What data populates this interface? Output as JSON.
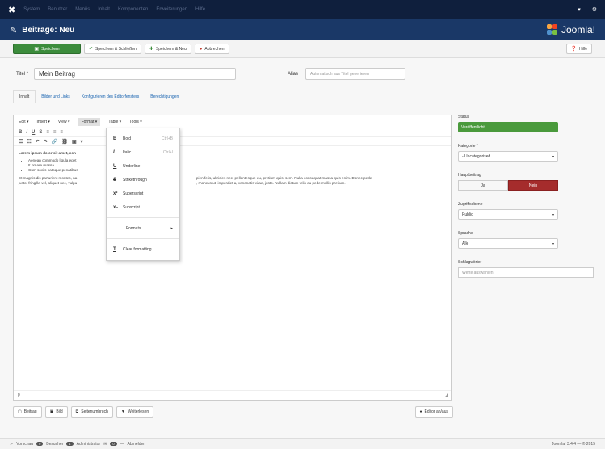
{
  "topnav": {
    "menu": [
      "System",
      "Benutzer",
      "Menüs",
      "Inhalt",
      "Komponenten",
      "Erweiterungen",
      "Hilfe"
    ]
  },
  "header": {
    "title": "Beiträge: Neu",
    "brand": "Joomla!"
  },
  "toolbar": {
    "save": "Speichern",
    "save_close": "Speichern & Schließen",
    "save_new": "Speichern & Neu",
    "cancel": "Abbrechen",
    "help": "Hilfe"
  },
  "form": {
    "title_label": "Titel *",
    "title_value": "Mein Beitrag",
    "alias_label": "Alias",
    "alias_placeholder": "Automatisch aus Titel generieren"
  },
  "tabs": [
    "Inhalt",
    "Bilder und Links",
    "Konfigurieren des Editorfensters",
    "Berechtigungen"
  ],
  "editor": {
    "menubar": [
      "Edit ▾",
      "Insert ▾",
      "View ▾",
      "Format ▾",
      "Table ▾",
      "Tools ▾"
    ],
    "heading": "Lorem ipsum dolor sit amet, con",
    "bullets": [
      "Aenean commodo ligula eget",
      "It ornare massa.",
      "Cum sociis natoque penatibus"
    ],
    "para_left": "Et magnis dis parturient montes, na",
    "para_left2": "justo, fringilla vel, aliquet nec, vulpu",
    "para_right": "pien felis, ultricies nec, pellentesque eu, pretium quis, sem. Nulla consequat massa quis enim. Donec pede",
    "para_right2": ", rhoncus ut, imperdiet a, venenatis vitae, justo. Nullam dictum felis eu pede mollis pretium.",
    "status": "p"
  },
  "format_menu": {
    "items": [
      {
        "icon": "B",
        "label": "Bold",
        "shortcut": "Ctrl+B"
      },
      {
        "icon": "I",
        "label": "Italic",
        "shortcut": "Ctrl+I"
      },
      {
        "icon": "U",
        "label": "Underline",
        "shortcut": ""
      },
      {
        "icon": "S",
        "label": "Strikethrough",
        "shortcut": ""
      },
      {
        "icon": "x²",
        "label": "Superscript",
        "shortcut": ""
      },
      {
        "icon": "x₂",
        "label": "Subscript",
        "shortcut": ""
      }
    ],
    "formats": "Formats",
    "clear": "Clear formatting"
  },
  "bottom_buttons": {
    "article": "Beitrag",
    "image": "Bild",
    "pagebreak": "Seitenumbruch",
    "readmore": "Weiterlesen",
    "toggle": "Editor an/aus"
  },
  "sidebar": {
    "status_label": "Status",
    "status_value": "Veröffentlicht",
    "category_label": "Kategorie *",
    "category_value": "- Uncategorised",
    "featured_label": "Hauptbeitrag",
    "featured_yes": "Ja",
    "featured_no": "Nein",
    "access_label": "Zugriffsebene",
    "access_value": "Public",
    "language_label": "Sprache",
    "language_value": "Alle",
    "tags_label": "Schlagwörter",
    "tags_placeholder": "Werte auswählen"
  },
  "footer": {
    "view_site": "Vorschau",
    "visitors": "Besucher",
    "admins": "Administrator",
    "messages": "0",
    "logout": "Abmelden",
    "version": "Joomla! 3.4.4 — © 2015"
  },
  "colors": {
    "topnav": "#0f1f3d",
    "header": "#1a3867",
    "save": "#3c8c3c",
    "danger": "#a52c2c"
  }
}
